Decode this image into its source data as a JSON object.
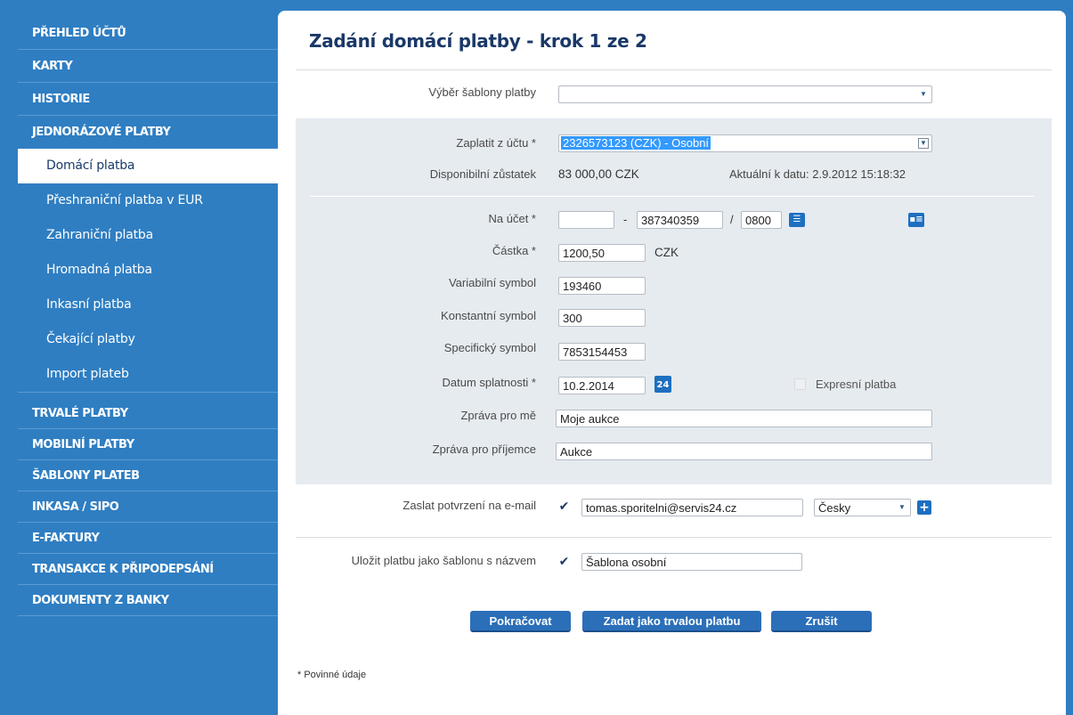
{
  "sidebar": {
    "items": [
      {
        "label": "PŘEHLED ÚČTŮ"
      },
      {
        "label": "KARTY"
      },
      {
        "label": "HISTORIE"
      },
      {
        "label": "JEDNORÁZOVÉ PLATBY"
      }
    ],
    "sub": [
      {
        "label": "Domácí platba"
      },
      {
        "label": "Přeshraniční platba v EUR"
      },
      {
        "label": "Zahraniční platba"
      },
      {
        "label": "Hromadná platba"
      },
      {
        "label": "Inkasní platba"
      },
      {
        "label": "Čekající platby"
      },
      {
        "label": "Import plateb"
      }
    ],
    "items2": [
      {
        "label": "TRVALÉ PLATBY"
      },
      {
        "label": "MOBILNÍ PLATBY"
      },
      {
        "label": "ŠABLONY PLATEB"
      },
      {
        "label": "INKASA / SIPO"
      },
      {
        "label": "E-FAKTURY"
      },
      {
        "label": "TRANSAKCE K PŘIPODEPSÁNÍ"
      },
      {
        "label": "DOKUMENTY Z BANKY"
      }
    ]
  },
  "form": {
    "title": "Zadání domácí platby - krok 1 ze 2",
    "template_label": "Výběr šablony platby",
    "template_value": "",
    "pay_from_label": "Zaplatit z účtu *",
    "pay_from_value": "2326573123 (CZK) - Osobní",
    "balance_label": "Disponibilní zůstatek",
    "balance_value": "83 000,00 CZK",
    "balance_date": "Aktuální k datu: 2.9.2012 15:18:32",
    "to_account_label": "Na účet *",
    "to_prefix": "",
    "dash": "-",
    "to_number": "387340359",
    "slash": "/",
    "bank_code": "0800",
    "amount_label": "Částka *",
    "amount_value": "1200,50",
    "currency": "CZK",
    "vs_label": "Variabilní symbol",
    "vs_value": "193460",
    "ks_label": "Konstantní symbol",
    "ks_value": "300",
    "ss_label": "Specifický symbol",
    "ss_value": "7853154453",
    "due_label": "Datum splatnosti *",
    "due_value": "10.2.2014",
    "express_label": "Expresní platba",
    "msg_me_label": "Zpráva pro mě",
    "msg_me_value": "Moje aukce",
    "msg_rcpt_label": "Zpráva pro příjemce",
    "msg_rcpt_value": "Aukce",
    "email_label": "Zaslat potvrzení na e-mail",
    "email_value": "tomas.sporitelni@servis24.cz",
    "lang_value": "Česky",
    "save_tpl_label": "Uložit platbu jako šablonu s názvem",
    "save_tpl_value": "Šablona osobní",
    "calendar_day": "24"
  },
  "buttons": {
    "continue": "Pokračovat",
    "standing": "Zadat jako trvalou platbu",
    "cancel": "Zrušit"
  },
  "footnote": "* Povinné údaje"
}
